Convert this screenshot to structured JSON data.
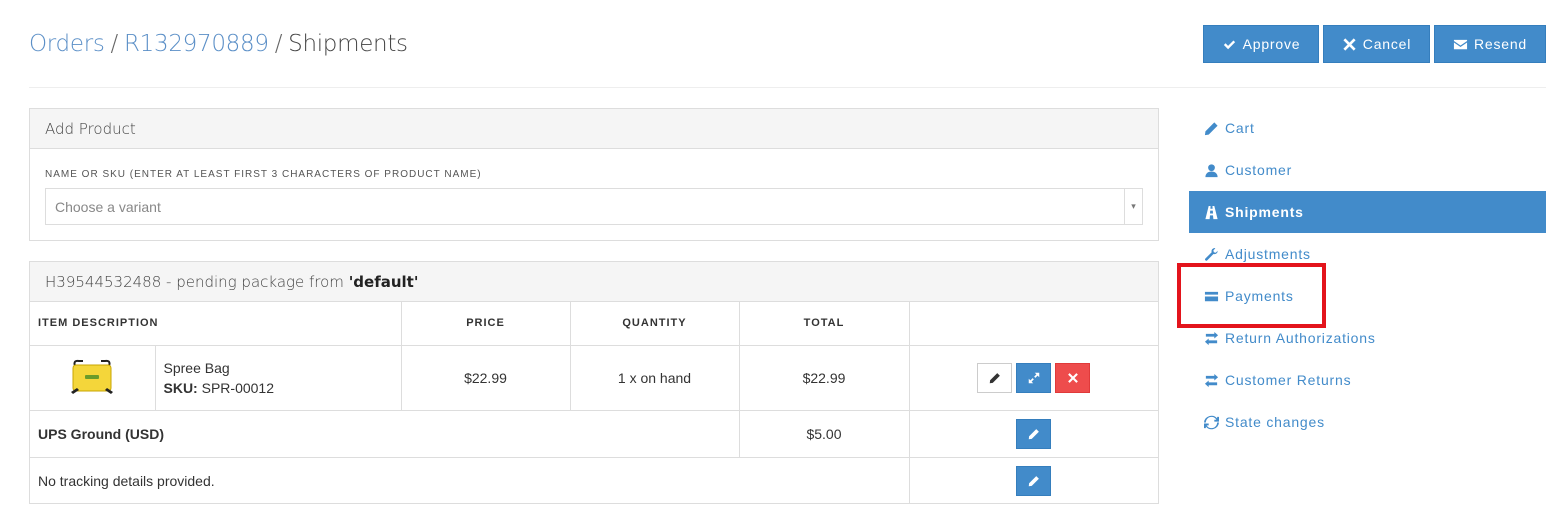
{
  "breadcrumb": {
    "orders": "Orders",
    "sep1": "/",
    "order_number": "R132970889",
    "sep2": "/",
    "current": "Shipments"
  },
  "top_actions": {
    "approve": "Approve",
    "cancel": "Cancel",
    "resend": "Resend"
  },
  "add_product": {
    "heading": "Add Product",
    "field_label": "NAME OR SKU (ENTER AT LEAST FIRST 3 CHARACTERS OF PRODUCT NAME)",
    "placeholder": "Choose a variant",
    "arrow": "▾"
  },
  "shipment": {
    "number": "H39544532488",
    "status_text": " - pending package from ",
    "stock_location": "'default'",
    "columns": {
      "item_description": "ITEM DESCRIPTION",
      "price": "PRICE",
      "quantity": "QUANTITY",
      "total": "TOTAL"
    },
    "item": {
      "name": "Spree Bag",
      "sku_label": "SKU:",
      "sku": " SPR-00012",
      "price": "$22.99",
      "quantity": "1 x on hand",
      "total": "$22.99"
    },
    "shipping_method": "UPS Ground (USD)",
    "shipping_cost": "$5.00",
    "tracking": "No tracking details provided."
  },
  "sidebar": {
    "items": [
      {
        "label": "Cart",
        "icon": "pencil-icon"
      },
      {
        "label": "Customer",
        "icon": "user-icon"
      },
      {
        "label": "Shipments",
        "icon": "road-icon",
        "active": true
      },
      {
        "label": "Adjustments",
        "icon": "wrench-icon"
      },
      {
        "label": "Payments",
        "icon": "credit-card-icon"
      },
      {
        "label": "Return Authorizations",
        "icon": "transfer-icon"
      },
      {
        "label": "Customer Returns",
        "icon": "transfer-icon"
      },
      {
        "label": "State changes",
        "icon": "refresh-icon"
      }
    ]
  },
  "colors": {
    "primary": "#428bca",
    "danger": "#ee4c4c",
    "highlight": "#e3141c",
    "link": "#5b8fc7"
  }
}
